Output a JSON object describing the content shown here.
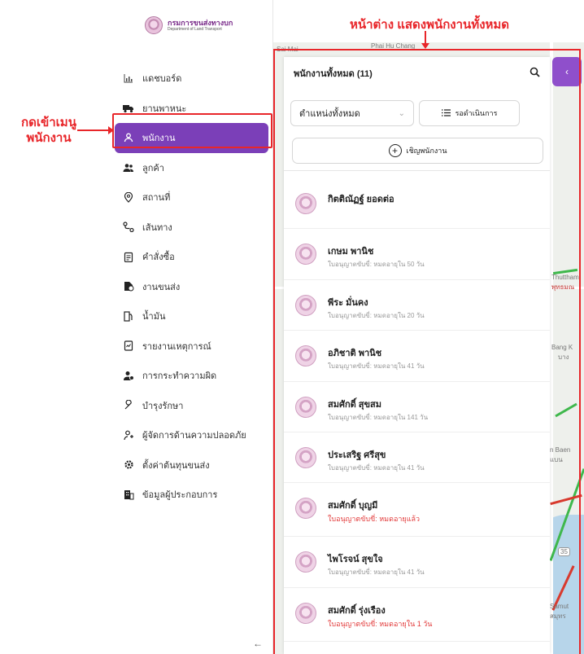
{
  "logo": {
    "title": "กรมการขนส่งทางบก",
    "subtitle": "Department of Land Transport"
  },
  "sidebar": {
    "items": [
      {
        "label": "แดชบอร์ด",
        "icon": "chart-icon"
      },
      {
        "label": "ยานพาหนะ",
        "icon": "truck-icon"
      },
      {
        "label": "พนักงาน",
        "icon": "user-icon",
        "active": true
      },
      {
        "label": "ลูกค้า",
        "icon": "users-icon"
      },
      {
        "label": "สถานที่",
        "icon": "location-pin-icon"
      },
      {
        "label": "เส้นทาง",
        "icon": "route-icon"
      },
      {
        "label": "คำสั่งซื้อ",
        "icon": "clipboard-icon"
      },
      {
        "label": "งานขนส่ง",
        "icon": "delivery-icon"
      },
      {
        "label": "น้ำมัน",
        "icon": "fuel-icon"
      },
      {
        "label": "รายงานเหตุการณ์",
        "icon": "report-icon"
      },
      {
        "label": "การกระทำความผิด",
        "icon": "violation-icon"
      },
      {
        "label": "บำรุงรักษา",
        "icon": "wrench-icon"
      },
      {
        "label": "ผู้จัดการด้านความปลอดภัย",
        "icon": "safety-manager-icon"
      },
      {
        "label": "ตั้งค่าต้นทุนขนส่ง",
        "icon": "gear-icon"
      },
      {
        "label": "ข้อมูลผู้ประกอบการ",
        "icon": "building-icon"
      }
    ],
    "collapse": "←"
  },
  "annotations": {
    "menu_label_line1": "กดเข้าเมนู",
    "menu_label_line2": "พนักงาน",
    "panel_label": "หน้าต่าง แสดงพนักงานทั้งหมด"
  },
  "panel": {
    "title": "พนักงานทั้งหมด (11)",
    "position_filter": "ตำแหน่งทั้งหมด",
    "status_filter": "รอดำเนินการ",
    "invite_label": "เชิญพนักงาน"
  },
  "employees": [
    {
      "name": "กิตติณัฏฐ์ ยอดต่อ",
      "license": "",
      "warn": false
    },
    {
      "name": "เกษม พานิช",
      "license": "ใบอนุญาตขับขี่: หมดอายุใน 50 วัน",
      "warn": false
    },
    {
      "name": "พีระ มั่นคง",
      "license": "ใบอนุญาตขับขี่: หมดอายุใน 20 วัน",
      "warn": false
    },
    {
      "name": "อภิชาติ พานิช",
      "license": "ใบอนุญาตขับขี่: หมดอายุใน 41 วัน",
      "warn": false
    },
    {
      "name": "สมศักดิ์ สุขสม",
      "license": "ใบอนุญาตขับขี่: หมดอายุใน 141 วัน",
      "warn": false
    },
    {
      "name": "ประเสริฐ ศรีสุข",
      "license": "ใบอนุญาตขับขี่: หมดอายุใน 41 วัน",
      "warn": false
    },
    {
      "name": "สมศักดิ์ บุญมี",
      "license": "ใบอนุญาตขับขี่: หมดอายุแล้ว",
      "warn": true
    },
    {
      "name": "ไพโรจน์ สุขใจ",
      "license": "ใบอนุญาตขับขี่: หมดอายุใน 41 วัน",
      "warn": false
    },
    {
      "name": "สมศักดิ์ รุ่งเรือง",
      "license": "ใบอนุญาตขับขี่: หมดอายุใน 1 วัน",
      "warn": true
    }
  ],
  "map": {
    "labels": [
      "Sai Mai",
      "Phai Hu Chang",
      "Thuttham",
      "พุทธมณ",
      "Bang K",
      "บาง",
      "n Baen",
      "แบน",
      "Samut",
      "สมุทร",
      "35"
    ],
    "colors": {
      "water": "#b7d5ea",
      "traffic_green": "#3fb84c",
      "traffic_red": "#d83a2e"
    }
  },
  "colors": {
    "accent": "#7b3fb8",
    "annotation": "#e8262a",
    "warning": "#e23a3a"
  }
}
